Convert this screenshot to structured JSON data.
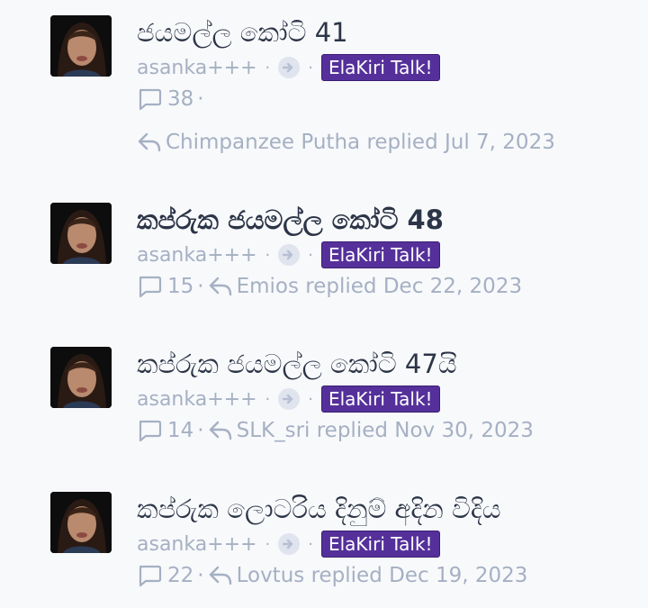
{
  "threads": [
    {
      "title": "ජයමල්ල කෝටි 41",
      "author": "asanka+++",
      "forum": "ElaKiri Talk!",
      "replies": "38",
      "last_poster": "Chimpanzee Putha",
      "replied_label": "replied",
      "date": "Jul 7, 2023"
    },
    {
      "title": "කප්රුක ජයමල්ල කෝටි 48",
      "author": "asanka+++",
      "forum": "ElaKiri Talk!",
      "replies": "15",
      "last_poster": "Emios",
      "replied_label": "replied",
      "date": "Dec 22, 2023"
    },
    {
      "title": "කප්රුක ජයමල්ල කෝටි 47යි",
      "author": "asanka+++",
      "forum": "ElaKiri Talk!",
      "replies": "14",
      "last_poster": "SLK_sri",
      "replied_label": "replied",
      "date": "Nov 30, 2023"
    },
    {
      "title": "කප්රුක ලොටරිය දිනුම් අදින විදිය",
      "author": "asanka+++",
      "forum": "ElaKiri Talk!",
      "replies": "22",
      "last_poster": "Lovtus",
      "replied_label": "replied",
      "date": "Dec 19, 2023"
    }
  ],
  "separators": {
    "dot": "·"
  },
  "colors": {
    "title": "#2c3547",
    "muted": "#a5b0c3",
    "tag_bg": "#55309a",
    "tag_text": "#ffffff",
    "background": "#f8f9fb"
  },
  "icons": {
    "reply_count": "comment-bubble-icon",
    "last_reply": "reply-arrow-icon",
    "posted_in": "arrow-right-circle-icon"
  }
}
